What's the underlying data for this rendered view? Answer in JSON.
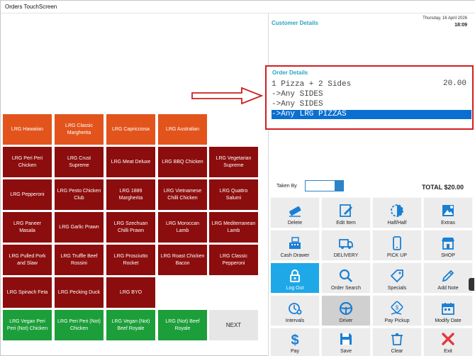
{
  "window": {
    "title": "Orders TouchScreen"
  },
  "customer": {
    "label": "Customer Details",
    "date": "Thursday, 16 April 2026",
    "time": "18:09"
  },
  "order": {
    "label": "Order Details",
    "lines": [
      "1 Pizza + 2 Sides",
      "->Any SIDES",
      "->Any SIDES",
      "->Any LRG PIZZAS"
    ],
    "price": "20.00",
    "selected_index": 3
  },
  "taken_by": {
    "label": "Taken By",
    "value": ""
  },
  "total": {
    "label": "TOTAL",
    "value": "$20.00"
  },
  "menu": [
    {
      "label": "LRG Hawaiian",
      "color": "orange"
    },
    {
      "label": "LRG Classic Margherita",
      "color": "orange"
    },
    {
      "label": "LRG Capricciosa",
      "color": "orange"
    },
    {
      "label": "LRG Australian",
      "color": "orange"
    },
    {
      "label": "LRG Peri Peri Chicken",
      "color": "red"
    },
    {
      "label": "LRG Crust Supreme",
      "color": "red"
    },
    {
      "label": "LRG Meat Deluxe",
      "color": "red"
    },
    {
      "label": "LRG BBQ Chicken",
      "color": "red"
    },
    {
      "label": "LRG Vegetarian Supreme",
      "color": "red"
    },
    {
      "label": "LRG Pepperoni",
      "color": "red"
    },
    {
      "label": "LRG Pesto Chicken Club",
      "color": "red"
    },
    {
      "label": "LRG 1889 Margherita",
      "color": "red"
    },
    {
      "label": "LRG Vietnamese Chilli Chicken",
      "color": "red"
    },
    {
      "label": "LRG Quattro Salumi",
      "color": "red"
    },
    {
      "label": "LRG Paneer Masala",
      "color": "red"
    },
    {
      "label": "LRG Garlic Prawn",
      "color": "red"
    },
    {
      "label": "LRG Szechuan Chilli Prawn",
      "color": "red"
    },
    {
      "label": "LRG Moroccan Lamb",
      "color": "red"
    },
    {
      "label": "LRG Mediterranean Lamb",
      "color": "red"
    },
    {
      "label": "LRG Pulled Pork and Slaw",
      "color": "red"
    },
    {
      "label": "LRG Truffle Beef Rossini",
      "color": "red"
    },
    {
      "label": "LRG Prosciutto Rocket",
      "color": "red"
    },
    {
      "label": "LRG Roast Chicken Bacon",
      "color": "red"
    },
    {
      "label": "LRG Classic Pepperoni",
      "color": "red"
    },
    {
      "label": "LRG Spinach Feta",
      "color": "red"
    },
    {
      "label": "LRG Pecking Duck",
      "color": "red"
    },
    {
      "label": "LRG BYO",
      "color": "red"
    },
    {
      "label": "LRG Vegan Peri Peri (Not) Chicken",
      "color": "green"
    },
    {
      "label": "LRG Peri Peri (Not) Chicken",
      "color": "green"
    },
    {
      "label": "LRG Vegan (Not) Beef Royale",
      "color": "green"
    },
    {
      "label": "LRG (Not) Beef Royale",
      "color": "green"
    },
    {
      "label": "NEXT",
      "color": "next"
    }
  ],
  "functions": [
    {
      "label": "Delete",
      "icon": "eraser-icon"
    },
    {
      "label": "Edit Item",
      "icon": "edit-icon"
    },
    {
      "label": "Half/Half",
      "icon": "half-circle-icon"
    },
    {
      "label": "Extras",
      "icon": "image-plus-icon"
    },
    {
      "label": "Cash Drawer",
      "icon": "cash-register-icon"
    },
    {
      "label": "DELIVERY",
      "icon": "truck-icon"
    },
    {
      "label": "PICK UP",
      "icon": "phone-icon"
    },
    {
      "label": "SHOP",
      "icon": "shop-icon"
    },
    {
      "label": "Log Out",
      "icon": "lock-icon"
    },
    {
      "label": "Order Search",
      "icon": "search-icon"
    },
    {
      "label": "Specials",
      "icon": "tag-icon"
    },
    {
      "label": "Add Note",
      "icon": "pencil-icon"
    },
    {
      "label": "Intervals",
      "icon": "clock-plus-icon"
    },
    {
      "label": "Driver",
      "icon": "steering-wheel-icon"
    },
    {
      "label": "Pay Pickup",
      "icon": "hand-coin-icon"
    },
    {
      "label": "Modify Date",
      "icon": "calendar-icon"
    },
    {
      "label": "Pay",
      "icon": "dollar-icon"
    },
    {
      "label": "Save",
      "icon": "save-icon"
    },
    {
      "label": "Clear",
      "icon": "clear-icon"
    },
    {
      "label": "Exit",
      "icon": "close-icon"
    }
  ]
}
